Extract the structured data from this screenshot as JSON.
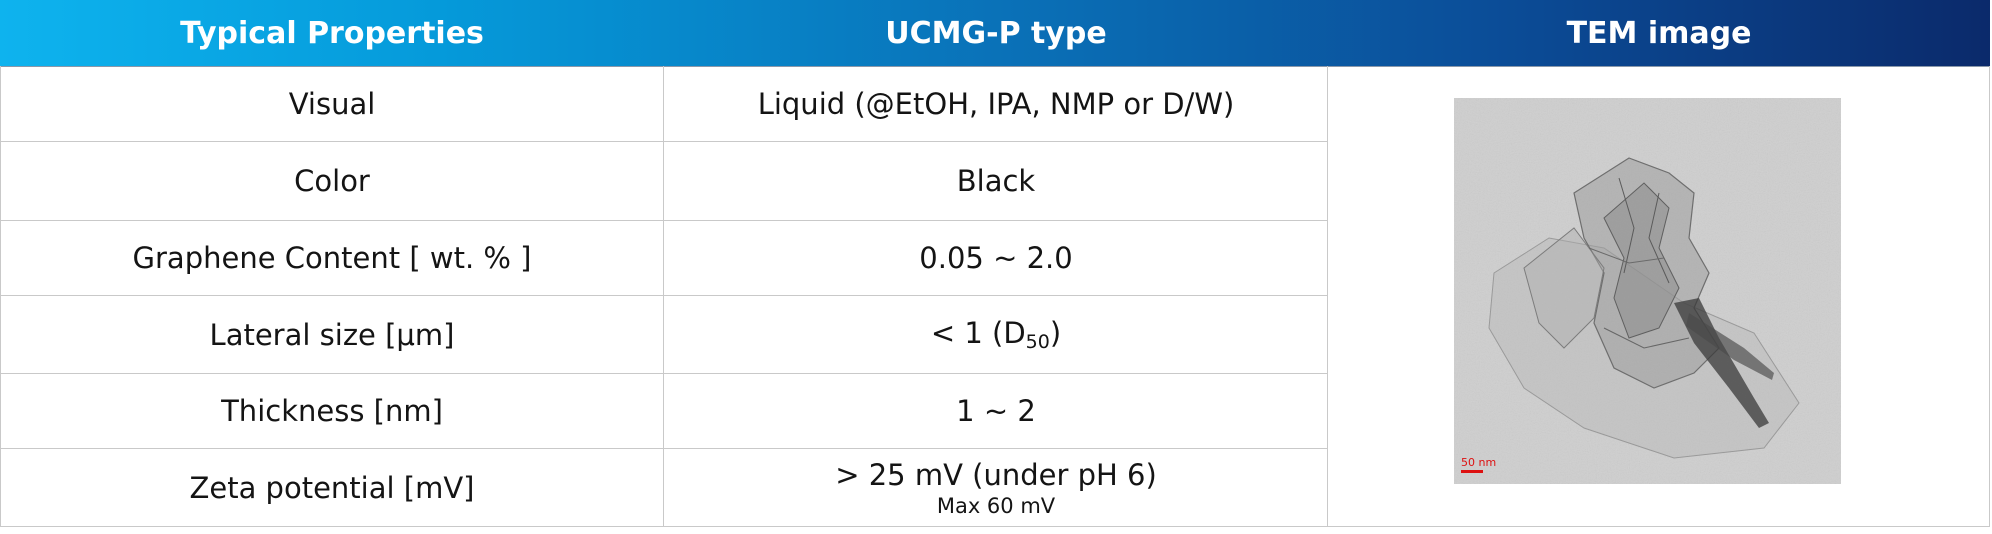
{
  "header": {
    "col1": "Typical Properties",
    "col2": "UCMG-P type",
    "col3": "TEM image"
  },
  "rows": [
    {
      "property": "Visual",
      "value": "Liquid (@EtOH, IPA, NMP or D/W)"
    },
    {
      "property": "Color",
      "value": "Black"
    },
    {
      "property": "Graphene Content [ wt. % ]",
      "value": "0.05 ~ 2.0"
    },
    {
      "property": "Lateral size [μm]",
      "value_main": "< 1 (D",
      "value_sub": "50",
      "value_end": ")"
    },
    {
      "property": "Thickness [nm]",
      "value": "1 ~ 2"
    },
    {
      "property": "Zeta potential [mV]",
      "value": "> 25 mV (under pH 6)",
      "note": "Max 60 mV"
    }
  ],
  "tem_image": {
    "scale_label": "50 nm",
    "scale_color": "#d11111"
  },
  "colors": {
    "header_start": "#0eb3ee",
    "header_end": "#0b2a6b",
    "grid": "#c9c9c9"
  }
}
